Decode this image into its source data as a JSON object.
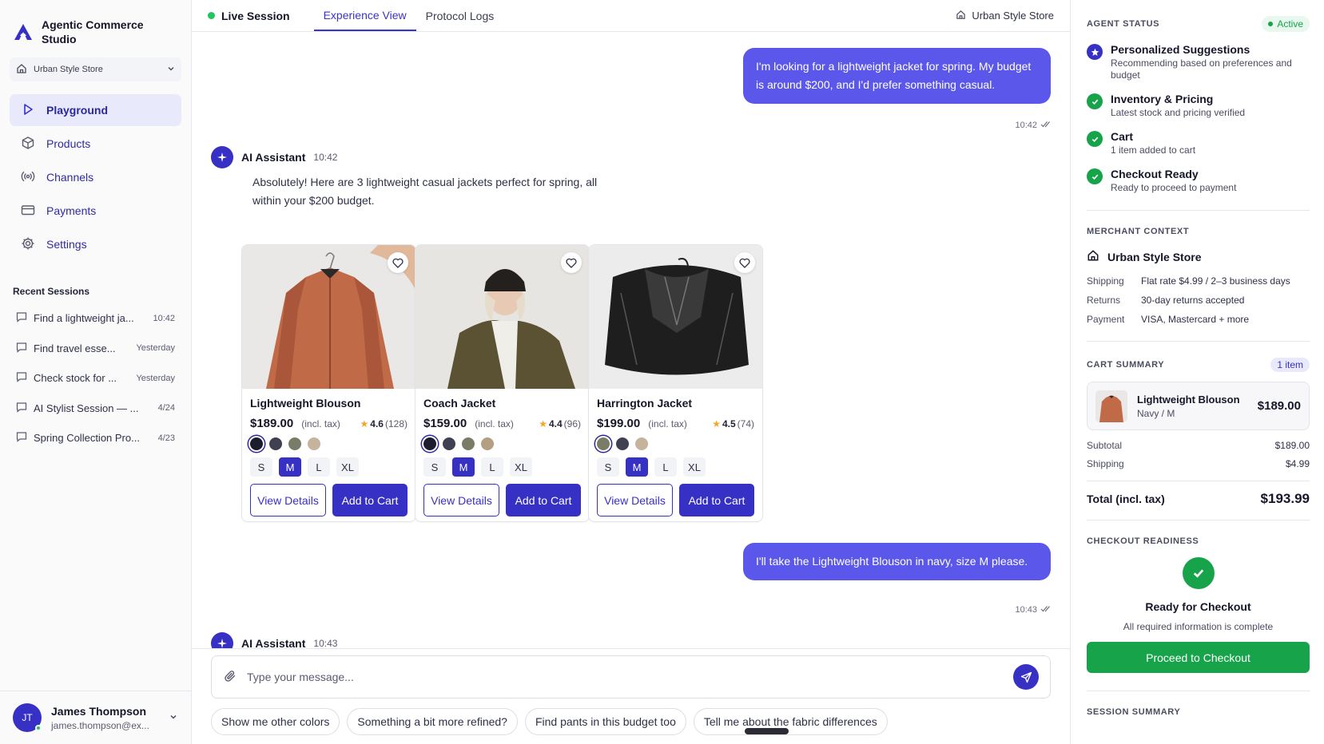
{
  "brand": {
    "name": "Agentic Commerce Studio",
    "store_selector": "Urban Style Store"
  },
  "nav": [
    {
      "label": "Playground",
      "icon": "play-icon",
      "active": true
    },
    {
      "label": "Products",
      "icon": "box-icon"
    },
    {
      "label": "Channels",
      "icon": "broadcast-icon"
    },
    {
      "label": "Payments",
      "icon": "credit-card-icon"
    },
    {
      "label": "Settings",
      "icon": "gear-icon"
    }
  ],
  "recent": {
    "title": "Recent Sessions",
    "items": [
      {
        "label": "Find a lightweight ja...",
        "time": "10:42"
      },
      {
        "label": "Find travel esse...",
        "time": "Yesterday"
      },
      {
        "label": "Check stock for ...",
        "time": "Yesterday"
      },
      {
        "label": "AI Stylist Session — ...",
        "time": "4/24"
      },
      {
        "label": "Spring Collection Pro...",
        "time": "4/23"
      }
    ]
  },
  "user": {
    "initials": "JT",
    "name": "James Thompson",
    "email": "james.thompson@ex..."
  },
  "topbar": {
    "live": "Live Session",
    "tabs": [
      "Experience View",
      "Protocol Logs"
    ],
    "store": "Urban Style Store"
  },
  "chat": {
    "msg1": {
      "text": "I'm looking for a lightweight jacket for spring. My budget is around $200, and I'd prefer something casual.",
      "time": "10:42"
    },
    "ai1": {
      "name": "AI Assistant",
      "time": "10:42",
      "text": "Absolutely! Here are 3 lightweight casual jackets perfect for spring, all within your $200 budget."
    },
    "products": [
      {
        "name": "Lightweight Blouson",
        "price": "$189.00",
        "tax": "(incl. tax)",
        "rating": "4.6",
        "count": "(128)",
        "colors": [
          "#1c1c2e",
          "#3f4150",
          "#7b7c68",
          "#c5b39c"
        ],
        "sizes": [
          "S",
          "M",
          "L",
          "XL"
        ],
        "selected_size": "M",
        "btn_details": "View Details",
        "btn_cart": "Add to Cart"
      },
      {
        "name": "Coach Jacket",
        "price": "$159.00",
        "tax": "(incl. tax)",
        "rating": "4.4",
        "count": "(96)",
        "colors": [
          "#1c1c2e",
          "#3f4150",
          "#7b7c68",
          "#b59f82"
        ],
        "sizes": [
          "S",
          "M",
          "L",
          "XL"
        ],
        "selected_size": "M",
        "btn_details": "View Details",
        "btn_cart": "Add to Cart"
      },
      {
        "name": "Harrington Jacket",
        "price": "$199.00",
        "tax": "(incl. tax)",
        "rating": "4.5",
        "count": "(74)",
        "colors": [
          "#7b7c68",
          "#3f4150",
          "#c5b39c"
        ],
        "sizes": [
          "S",
          "M",
          "L",
          "XL"
        ],
        "selected_size": "M",
        "btn_details": "View Details",
        "btn_cart": "Add to Cart"
      }
    ],
    "msg2": {
      "text": "I'll take the Lightweight Blouson in navy, size M please.",
      "time": "10:43"
    },
    "ai2": {
      "name": "AI Assistant",
      "time": "10:43"
    }
  },
  "composer": {
    "placeholder": "Type your message...",
    "chips": [
      "Show me other colors",
      "Something a bit more refined?",
      "Find pants in this budget too",
      "Tell me about the fabric differences"
    ]
  },
  "right": {
    "agent_status": {
      "title": "AGENT STATUS",
      "badge": "Active",
      "items": [
        {
          "title": "Personalized Suggestions",
          "desc": "Recommending based on preferences and budget",
          "state": "in-progress"
        },
        {
          "title": "Inventory & Pricing",
          "desc": "Latest stock and pricing verified",
          "state": "done"
        },
        {
          "title": "Cart",
          "desc": "1 item added to cart",
          "state": "done"
        },
        {
          "title": "Checkout Ready",
          "desc": "Ready to proceed to payment",
          "state": "done"
        }
      ]
    },
    "merchant": {
      "title": "MERCHANT CONTEXT",
      "store": "Urban Style Store",
      "rows": [
        {
          "k": "Shipping",
          "v": "Flat rate $4.99 / 2–3 business days"
        },
        {
          "k": "Returns",
          "v": "30-day returns accepted"
        },
        {
          "k": "Payment",
          "v": "VISA, Mastercard + more"
        }
      ]
    },
    "cart": {
      "title": "CART SUMMARY",
      "badge": "1 item",
      "item": {
        "name": "Lightweight Blouson",
        "variant": "Navy / M",
        "price": "$189.00"
      },
      "subtotal_k": "Subtotal",
      "subtotal_v": "$189.00",
      "shipping_k": "Shipping",
      "shipping_v": "$4.99",
      "total_k": "Total (incl. tax)",
      "total_v": "$193.99"
    },
    "checkout": {
      "title": "CHECKOUT READINESS",
      "ready_title": "Ready for Checkout",
      "ready_desc": "All required information is complete",
      "button": "Proceed to Checkout"
    },
    "session_title": "SESSION SUMMARY"
  },
  "colors": {
    "accent": "#3730c4",
    "bubble": "#5b57ea",
    "success": "#16a34a"
  }
}
